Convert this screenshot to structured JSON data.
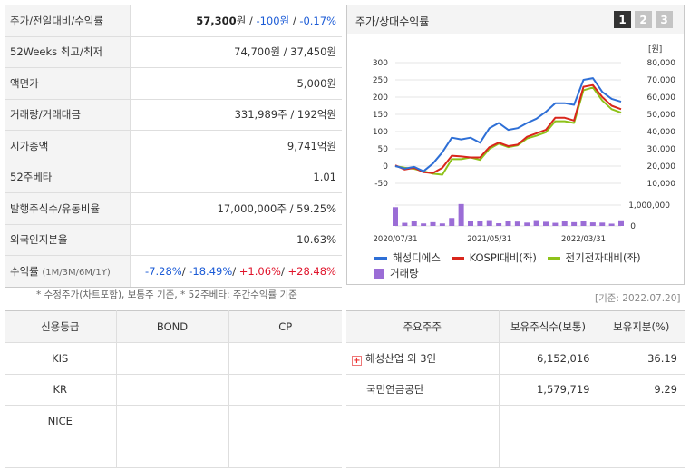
{
  "stock": {
    "price_label": "주가/전일대비/수익률",
    "price": "57,300",
    "price_unit": "원",
    "change": "-100원",
    "change_pct": "-0.17%",
    "weeks52_label": "52Weeks 최고/최저",
    "weeks52": "74,700원 / 37,450원",
    "face_label": "액면가",
    "face": "5,000원",
    "volume_label": "거래량/거래대금",
    "volume": "331,989주 / 192억원",
    "mcap_label": "시가총액",
    "mcap": "9,741억원",
    "beta_label": "52주베타",
    "beta": "1.01",
    "shares_label": "발행주식수/유동비율",
    "shares": "17,000,000주 / 59.25%",
    "foreign_label": "외국인지분율",
    "foreign": "10.63%",
    "return_label": "수익률",
    "return_sub": "(1M/3M/6M/1Y)",
    "returns": [
      "-7.28%",
      "-18.49%",
      "+1.06%",
      "+28.48%"
    ],
    "note": "* 수정주가(차트포함), 보통주 기준, * 52주베타: 주간수익률 기준"
  },
  "chart_panel": {
    "title": "주가/상대수익률",
    "pages": [
      "1",
      "2",
      "3"
    ],
    "base_date": "[기준: 2022.07.20]"
  },
  "chart_data": {
    "type": "line",
    "x": [
      "2020/07/31",
      "2020/08/31",
      "2020/09/30",
      "2020/10/31",
      "2020/11/30",
      "2020/12/31",
      "2021/01/31",
      "2021/02/28",
      "2021/03/31",
      "2021/04/30",
      "2021/05/31",
      "2021/06/30",
      "2021/07/31",
      "2021/08/31",
      "2021/09/30",
      "2021/10/31",
      "2021/11/30",
      "2021/12/31",
      "2022/01/31",
      "2022/02/28",
      "2022/03/31",
      "2022/04/30",
      "2022/05/31",
      "2022/06/30",
      "2022/07/20"
    ],
    "x_tick_labels": [
      "2020/07/31",
      "2021/05/31",
      "2022/03/31"
    ],
    "y_left": {
      "ticks": [
        "300",
        "250",
        "200",
        "150",
        "100",
        "50",
        "0",
        "-50"
      ],
      "range": [
        -50,
        300
      ]
    },
    "y_right": {
      "unit": "[원]",
      "ticks": [
        "80,000",
        "70,000",
        "60,000",
        "50,000",
        "40,000",
        "30,000",
        "20,000",
        "10,000"
      ],
      "range": [
        10000,
        80000
      ]
    },
    "y_volume": {
      "ticks": [
        "1,000,000",
        "0"
      ],
      "range": [
        0,
        1000000
      ]
    },
    "series": [
      {
        "name": "해성디에스",
        "color": "#2e6fd6",
        "axis": "right",
        "values": [
          20000,
          18500,
          19500,
          17000,
          21500,
          28000,
          36500,
          35500,
          36500,
          33500,
          42000,
          45000,
          41000,
          42000,
          45000,
          47500,
          51500,
          56500,
          56500,
          55500,
          70000,
          71000,
          63000,
          59000,
          57300
        ]
      },
      {
        "name": "KOSPI대비(좌)",
        "color": "#d9261c",
        "axis": "left",
        "values": [
          2,
          -10,
          -5,
          -18,
          -20,
          -5,
          30,
          28,
          25,
          25,
          55,
          68,
          58,
          62,
          85,
          95,
          105,
          140,
          140,
          132,
          230,
          235,
          200,
          175,
          165
        ]
      },
      {
        "name": "전기전자대비(좌)",
        "color": "#8ec21a",
        "axis": "left",
        "values": [
          0,
          -5,
          -8,
          -15,
          -22,
          -25,
          20,
          20,
          25,
          18,
          50,
          65,
          55,
          60,
          80,
          88,
          98,
          130,
          130,
          125,
          220,
          228,
          190,
          165,
          155
        ]
      }
    ],
    "volume": {
      "name": "거래량",
      "color": "#9b6dd6",
      "values": [
        900000,
        150000,
        220000,
        120000,
        180000,
        120000,
        380000,
        1050000,
        260000,
        230000,
        280000,
        130000,
        220000,
        210000,
        160000,
        280000,
        200000,
        150000,
        230000,
        180000,
        220000,
        170000,
        160000,
        110000,
        270000
      ]
    }
  },
  "credit": {
    "headers": [
      "신용등급",
      "BOND",
      "CP"
    ],
    "rows": [
      [
        "KIS",
        "",
        ""
      ],
      [
        "KR",
        "",
        ""
      ],
      [
        "NICE",
        "",
        ""
      ],
      [
        "",
        "",
        ""
      ]
    ]
  },
  "holders": {
    "headers": [
      "주요주주",
      "보유주식수(보통)",
      "보유지분(%)"
    ],
    "rows": [
      {
        "name": "해성산업 외 3인",
        "shares": "6,152,016",
        "pct": "36.19",
        "expandable": true
      },
      {
        "name": "국민연금공단",
        "shares": "1,579,719",
        "pct": "9.29",
        "expandable": false
      },
      {
        "name": "",
        "shares": "",
        "pct": "",
        "expandable": false
      },
      {
        "name": "",
        "shares": "",
        "pct": "",
        "expandable": false
      }
    ]
  }
}
